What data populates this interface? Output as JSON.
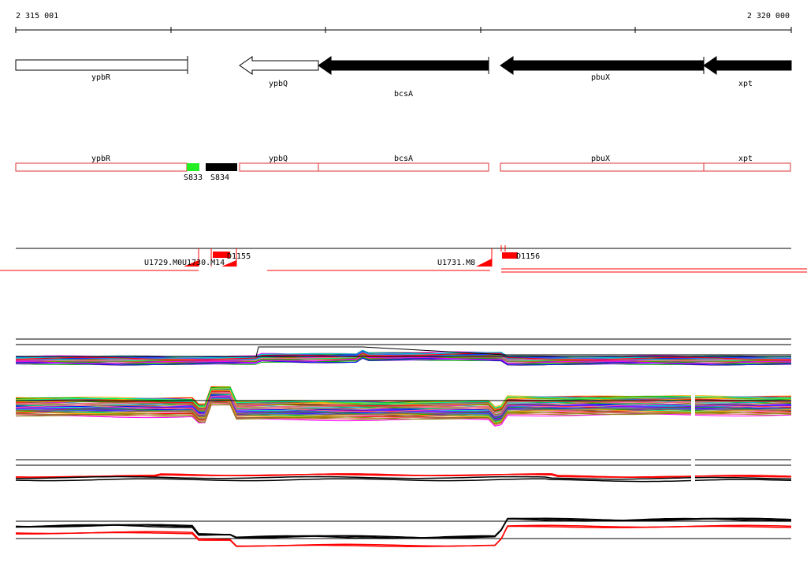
{
  "coordinates": {
    "start_label": "2 315 001",
    "end_label": "2 320 000"
  },
  "genes": [
    {
      "name": "ypbR",
      "strand": "+",
      "fill": "#ffffff"
    },
    {
      "name": "ypbQ",
      "strand": "-",
      "fill": "#ffffff"
    },
    {
      "name": "bcsA",
      "strand": "-",
      "fill": "#000000"
    },
    {
      "name": "pbuX",
      "strand": "-",
      "fill": "#000000"
    },
    {
      "name": "xpt",
      "strand": "-",
      "fill": "#000000"
    }
  ],
  "annotation_track": {
    "boxes": [
      "ypbR",
      "ypbQ",
      "bcsA",
      "pbuX",
      "xpt"
    ],
    "box_color": "#e03030",
    "segments": [
      {
        "label": "S833",
        "color": "#22ee22"
      },
      {
        "label": "S834",
        "color": "#000000"
      }
    ]
  },
  "features_track": {
    "labels": [
      "U1729.M0",
      "U1730.M14",
      "D1155",
      "U1731.M8",
      "D1156"
    ],
    "color": "#ff0000"
  },
  "expression_tracks": {
    "palette": [
      "#ff0000",
      "#00aa00",
      "#0000ff",
      "#ff00ff",
      "#00cccc",
      "#ffaa00",
      "#8800ff",
      "#888800",
      "#00ff88",
      "#ff6688",
      "#3366ff",
      "#996633"
    ]
  }
}
